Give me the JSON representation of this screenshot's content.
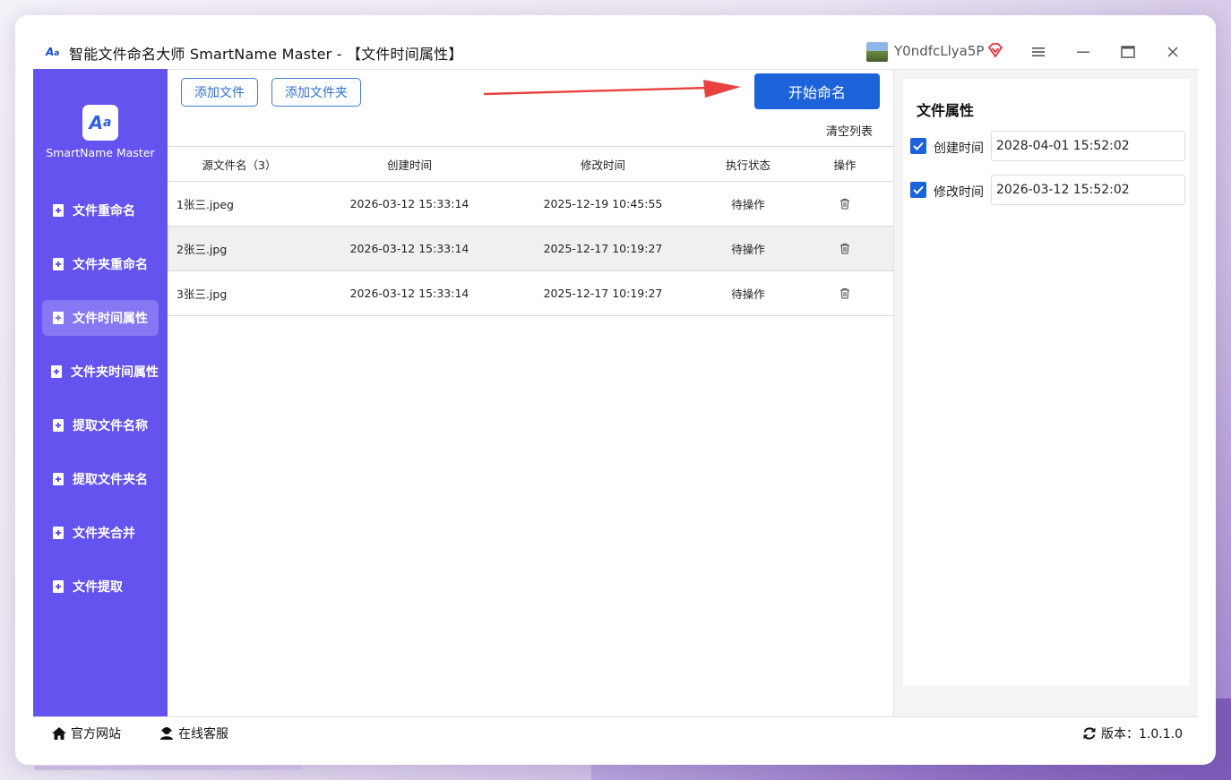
{
  "window": {
    "title": "智能文件命名大师 SmartName Master - 【文件时间属性】",
    "app_icon": "app-logo-icon",
    "user_name": "Y0ndfcLlya5P"
  },
  "sidebar": {
    "brand": "SmartName Master",
    "items": [
      {
        "label": "文件重命名",
        "active": false
      },
      {
        "label": "文件夹重命名",
        "active": false
      },
      {
        "label": "文件时间属性",
        "active": true
      },
      {
        "label": "文件夹时间属性",
        "active": false
      },
      {
        "label": "提取文件名称",
        "active": false
      },
      {
        "label": "提取文件夹名",
        "active": false
      },
      {
        "label": "文件夹合并",
        "active": false
      },
      {
        "label": "文件提取",
        "active": false
      }
    ]
  },
  "toolbar": {
    "add_file": "添加文件",
    "add_folder": "添加文件夹",
    "start": "开始命名",
    "clear_list": "清空列表"
  },
  "table": {
    "headers": {
      "name": "源文件名（3）",
      "created": "创建时间",
      "modified": "修改时间",
      "status": "执行状态",
      "action": "操作"
    },
    "rows": [
      {
        "name": "1张三.jpeg",
        "created": "2026-03-12 15:33:14",
        "modified": "2025-12-19 10:45:55",
        "status": "待操作"
      },
      {
        "name": "2张三.jpg",
        "created": "2026-03-12 15:33:14",
        "modified": "2025-12-17 10:19:27",
        "status": "待操作"
      },
      {
        "name": "3张三.jpg",
        "created": "2026-03-12 15:33:14",
        "modified": "2025-12-17 10:19:27",
        "status": "待操作"
      }
    ]
  },
  "attributes": {
    "title": "文件属性",
    "created_label": "创建时间",
    "created_value": "2028-04-01 15:52:02",
    "created_checked": true,
    "modified_label": "修改时间",
    "modified_value": "2026-03-12 15:52:02",
    "modified_checked": true
  },
  "footer": {
    "site": "官方网站",
    "service": "在线客服",
    "version": "版本：1.0.1.0"
  },
  "colors": {
    "sidebar": "#6453ee",
    "sidebar_active": "#8677f3",
    "primary": "#1c62d8",
    "arrow": "#e8413f"
  }
}
